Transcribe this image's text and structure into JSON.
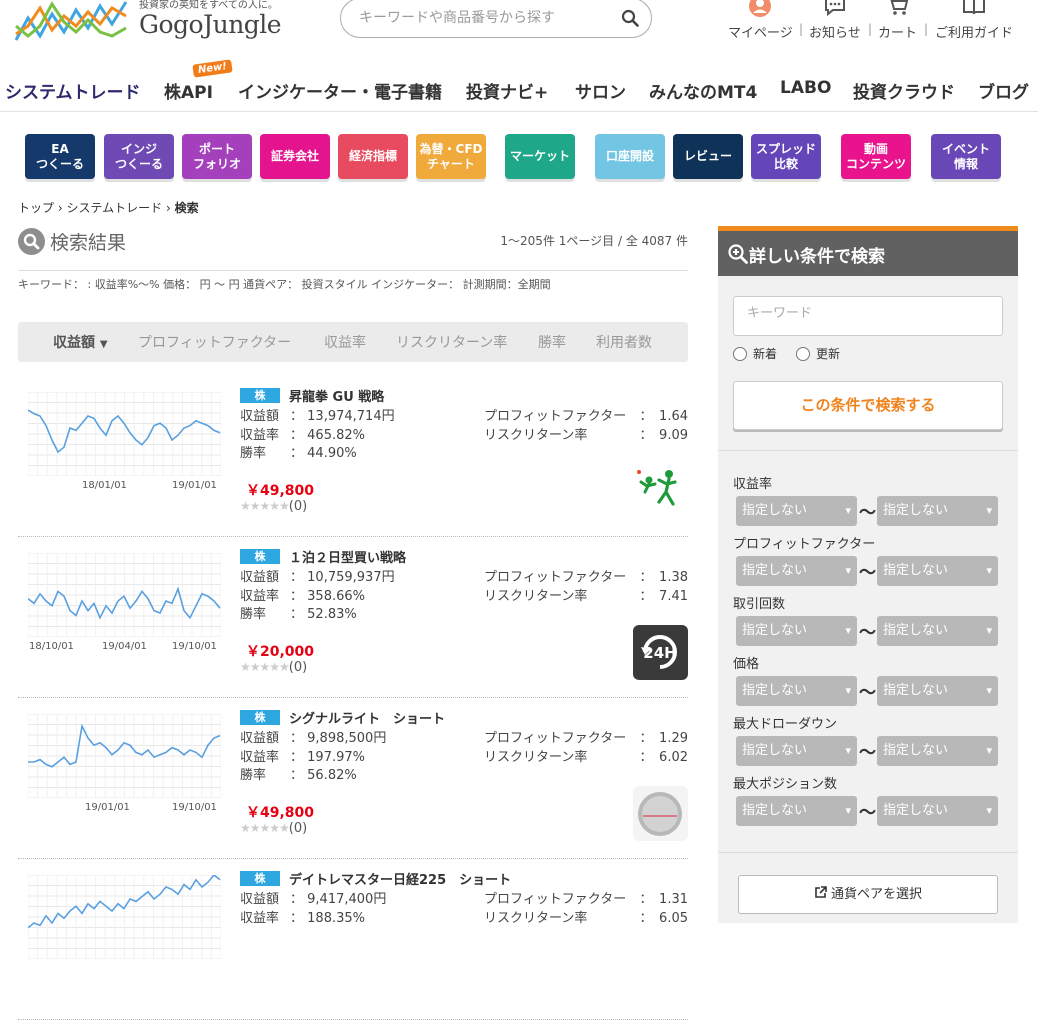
{
  "header": {
    "tagline": "投資家の英知をすべての人に。",
    "logo": "GogoJungle",
    "search_placeholder": "キーワードや商品番号から探す",
    "user_nav": [
      "マイページ",
      "お知らせ",
      "カート",
      "ご利用ガイド"
    ]
  },
  "main_nav": {
    "items": [
      "システムトレード",
      "株API",
      "インジケーター・電子書籍",
      "投資ナビ+",
      "サロン",
      "みんなのMT4",
      "LABO",
      "投資クラウド",
      "ブログ"
    ],
    "new_badge": "New!"
  },
  "categories": [
    {
      "label": "EA\nつくーる",
      "color": "#15396a"
    },
    {
      "label": "インジ\nつくーる",
      "color": "#6f49b4"
    },
    {
      "label": "ポート\nフォリオ",
      "color": "#a540bd"
    },
    {
      "label": "証券会社",
      "color": "#e4138e"
    },
    {
      "label": "経済指標",
      "color": "#e84a5f"
    },
    {
      "label": "為替・CFD\nチャート",
      "color": "#f0a93b"
    },
    {
      "label": "マーケット",
      "color": "#1fa789"
    },
    {
      "label": "口座開設",
      "color": "#73c5e4"
    },
    {
      "label": "レビュー",
      "color": "#0f3258"
    },
    {
      "label": "スプレッド\n比較",
      "color": "#6446b8"
    },
    {
      "label": "動画\nコンテンツ",
      "color": "#e9148d"
    },
    {
      "label": "イベント\n情報",
      "color": "#6a47b7"
    }
  ],
  "breadcrumb": {
    "home": "トップ",
    "section": "システムトレード",
    "current": "検索"
  },
  "results": {
    "title": "検索結果",
    "count": "1～205件 1ページ目 / 全 4087 件",
    "conditions": "キーワード：  :  収益率%～%  価格： 円 ～ 円   通貨ペア：   投資スタイル  インジケーター：   計測期間：全期間"
  },
  "sort": {
    "options": [
      "収益額",
      "プロフィットファクター",
      "収益率",
      "リスクリターン率",
      "勝率",
      "利用者数"
    ],
    "active_index": 0
  },
  "labels": {
    "badge": "株",
    "profit": "収益額",
    "rate": "収益率",
    "win": "勝率",
    "pf": "プロフィットファクター",
    "rr": "リスクリターン率",
    "colon": "："
  },
  "products": [
    {
      "name": "昇龍拳 GU 戦略",
      "profit": "13,974,714円",
      "rate": "465.82%",
      "win": "44.90%",
      "pf": "1.64",
      "rr": "9.09",
      "price": "￥49,800",
      "stars": "★★★★★",
      "reviews": "(0)",
      "x_ticks": [
        "18/01/01",
        "19/01/01"
      ],
      "line_color": "#5aa0e0",
      "thumb": "sport-icon"
    },
    {
      "name": "１泊２日型買い戦略",
      "profit": "10,759,937円",
      "rate": "358.66%",
      "win": "52.83%",
      "pf": "1.38",
      "rr": "7.41",
      "price": "￥20,000",
      "stars": "★★★★★",
      "reviews": "(0)",
      "x_ticks": [
        "18/10/01",
        "19/04/01",
        "19/10/01"
      ],
      "line_color": "#5aa0e0",
      "thumb": "24h-icon"
    },
    {
      "name": "シグナルライト　ショート",
      "profit": "9,898,500円",
      "rate": "197.97%",
      "win": "56.82%",
      "pf": "1.29",
      "rr": "6.02",
      "price": "￥49,800",
      "stars": "★★★★★",
      "reviews": "(0)",
      "x_ticks": [
        "19/01/01",
        "19/10/01"
      ],
      "line_color": "#5aa0e0",
      "thumb": "signal-light-logo"
    },
    {
      "name": "デイトレマスター日経225　ショート",
      "profit": "9,417,400円",
      "rate": "188.35%",
      "win": "",
      "pf": "1.31",
      "rr": "6.05",
      "price": "",
      "stars": "",
      "reviews": "",
      "x_ticks": [],
      "line_color": "#5aa0e0",
      "thumb": ""
    }
  ],
  "sidebar": {
    "title": "詳しい条件で検索",
    "keyword_placeholder": "キーワード",
    "radio_new": "新着",
    "radio_update": "更新",
    "search_button": "この条件で検索する",
    "filters": [
      "収益率",
      "プロフィットファクター",
      "取引回数",
      "価格",
      "最大ドローダウン",
      "最大ポジション数"
    ],
    "select_default": "指定しない",
    "tilde": "～",
    "pair_button": "通貨ペアを選択"
  },
  "colors": {
    "accent": "#f0831e",
    "nav_active": "#2d2a6b",
    "price": "#e60012",
    "badge": "#2ea7e0"
  }
}
